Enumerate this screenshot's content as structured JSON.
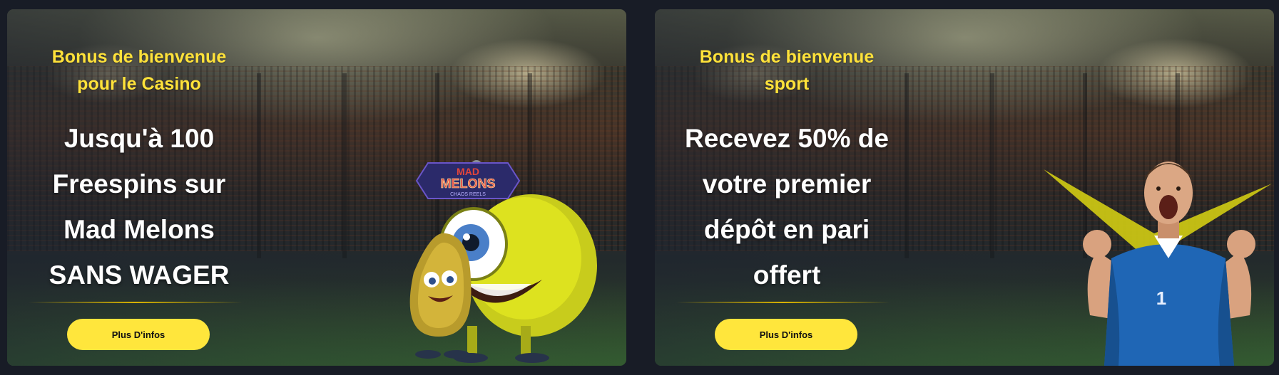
{
  "cards": [
    {
      "eyebrow": "Bonus de bienvenue\npour le Casino",
      "headline": "Jusqu'à 100\nFreespins sur\nMad Melons\nSANS WAGER",
      "button_label": "Plus D'infos",
      "art": {
        "logo_top": "MAD",
        "logo_main": "MELONS",
        "logo_sub": "CHAOS REELS"
      }
    },
    {
      "eyebrow": "Bonus de bienvenue\nsport",
      "headline": "Recevez 50% de\nvotre premier\ndépôt en pari\noffert",
      "button_label": "Plus D'infos",
      "art": {
        "jersey_number": "1"
      }
    }
  ],
  "colors": {
    "accent_yellow": "#ffe63c",
    "page_background": "#181c26",
    "headline_white": "#ffffff"
  }
}
